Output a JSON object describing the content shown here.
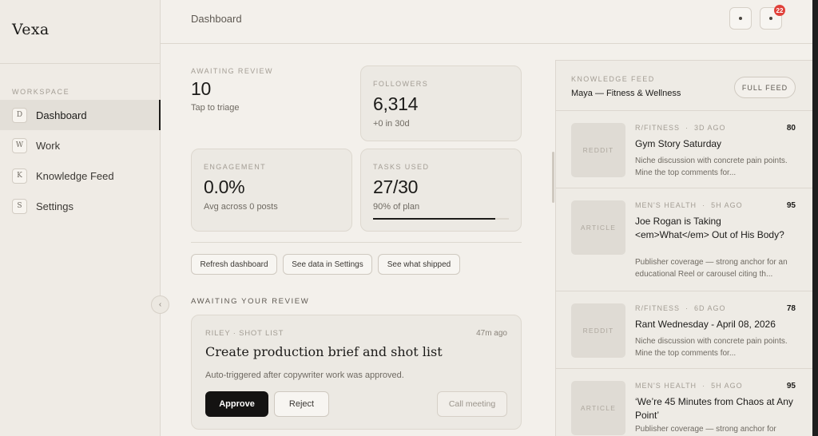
{
  "app": {
    "brand": "Vexa"
  },
  "sidebar": {
    "section_label": "WORKSPACE",
    "items": [
      {
        "key": "D",
        "label": "Dashboard",
        "active": true
      },
      {
        "key": "W",
        "label": "Work",
        "active": false
      },
      {
        "key": "K",
        "label": "Knowledge Feed",
        "active": false
      },
      {
        "key": "S",
        "label": "Settings",
        "active": false
      }
    ],
    "collapse_glyph": "‹"
  },
  "topbar": {
    "title": "Dashboard",
    "notification_count": "22"
  },
  "stats": {
    "awaiting": {
      "label": "AWAITING REVIEW",
      "value": "10",
      "sub": "Tap to triage"
    },
    "followers": {
      "label": "FOLLOWERS",
      "value": "6,314",
      "sub": "+0 in 30d"
    },
    "engagement": {
      "label": "ENGAGEMENT",
      "value": "0.0%",
      "sub": "Avg across 0 posts"
    },
    "tasks": {
      "label": "TASKS USED",
      "value": "27/30",
      "sub": "90% of plan",
      "progress": 0.9
    }
  },
  "actions": {
    "refresh": "Refresh dashboard",
    "settings": "See data in Settings",
    "shipped": "See what shipped"
  },
  "review": {
    "section_title": "AWAITING YOUR REVIEW",
    "card": {
      "meta": "RILEY · SHOT LIST",
      "time": "47m ago",
      "title": "Create production brief and shot list",
      "description": "Auto-triggered after copywriter work was approved.",
      "approve": "Approve",
      "reject": "Reject",
      "call": "Call meeting"
    }
  },
  "feed": {
    "label": "KNOWLEDGE FEED",
    "subtitle": "Maya — Fitness & Wellness",
    "full_feed": "FULL FEED",
    "items": [
      {
        "thumb": "REDDIT",
        "source": "R/FITNESS",
        "age": "3D AGO",
        "score": "80",
        "title": "Gym Story Saturday",
        "description": "Niche discussion with concrete pain points. Mine the top comments for..."
      },
      {
        "thumb": "ARTICLE",
        "source": "MEN'S HEALTH",
        "age": "5H AGO",
        "score": "95",
        "title": "Joe Rogan is Taking <em>What</em> Out of His Body?",
        "description": "Publisher coverage — strong anchor for an educational Reel or carousel citing th..."
      },
      {
        "thumb": "REDDIT",
        "source": "R/FITNESS",
        "age": "6D AGO",
        "score": "78",
        "title": "Rant Wednesday - April 08, 2026",
        "description": "Niche discussion with concrete pain points. Mine the top comments for..."
      },
      {
        "thumb": "ARTICLE",
        "source": "MEN'S HEALTH",
        "age": "5H AGO",
        "score": "95",
        "title": "‘We’re 45 Minutes from Chaos at Any Point’",
        "description": "Publisher coverage — strong anchor for"
      }
    ]
  }
}
